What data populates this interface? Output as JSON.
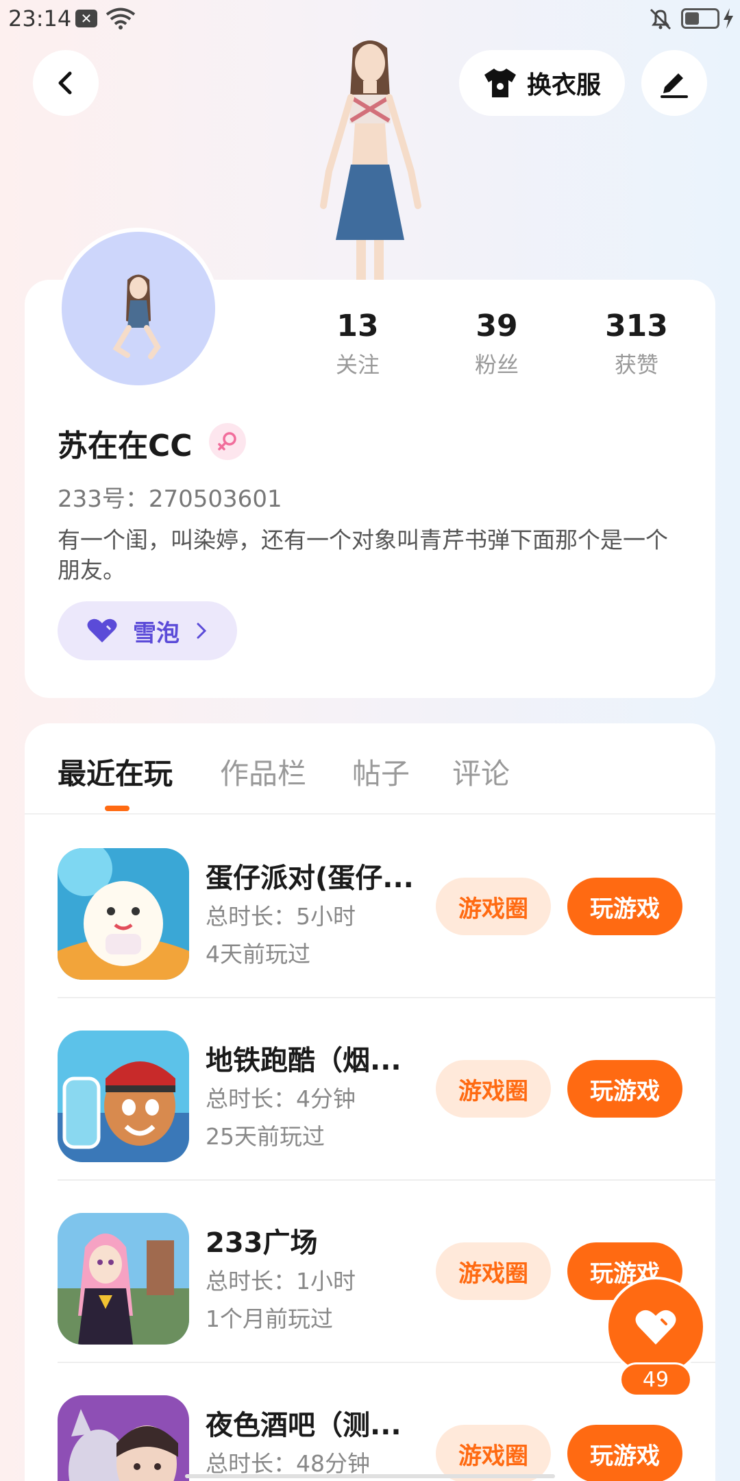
{
  "status_bar": {
    "time": "23:14",
    "notification_icon": "x-box-icon"
  },
  "header": {
    "dress_label": "换衣服"
  },
  "profile": {
    "stats": [
      {
        "num": "13",
        "label": "关注"
      },
      {
        "num": "39",
        "label": "粉丝"
      },
      {
        "num": "313",
        "label": "获赞"
      }
    ],
    "username": "苏在在CC",
    "uid": "233号：270503601",
    "bio": "有一个闺，叫染婷，还有一个对象叫青芹书弹下面那个是一个朋友。",
    "snow_label": "雪泡"
  },
  "tabs": [
    "最近在玩",
    "作品栏",
    "帖子",
    "评论"
  ],
  "games": [
    {
      "title": "蛋仔派对(蛋仔...",
      "time": "总时长：5小时",
      "ago": "4天前玩过",
      "circle": "游戏圈",
      "play": "玩游戏"
    },
    {
      "title": "地铁跑酷（烟...",
      "time": "总时长：4分钟",
      "ago": "25天前玩过",
      "circle": "游戏圈",
      "play": "玩游戏"
    },
    {
      "title": "233广场",
      "time": "总时长：1小时",
      "ago": "1个月前玩过",
      "circle": "游戏圈",
      "play": "玩游戏"
    },
    {
      "title": "夜色酒吧（测...",
      "time": "总时长：48分钟",
      "ago": "",
      "circle": "游戏圈",
      "play": "玩游戏"
    }
  ],
  "like": {
    "count": "49"
  },
  "colors": {
    "accent": "#ff6a12",
    "accent_light": "#ffe9da",
    "snow": "#5b4bd8"
  }
}
